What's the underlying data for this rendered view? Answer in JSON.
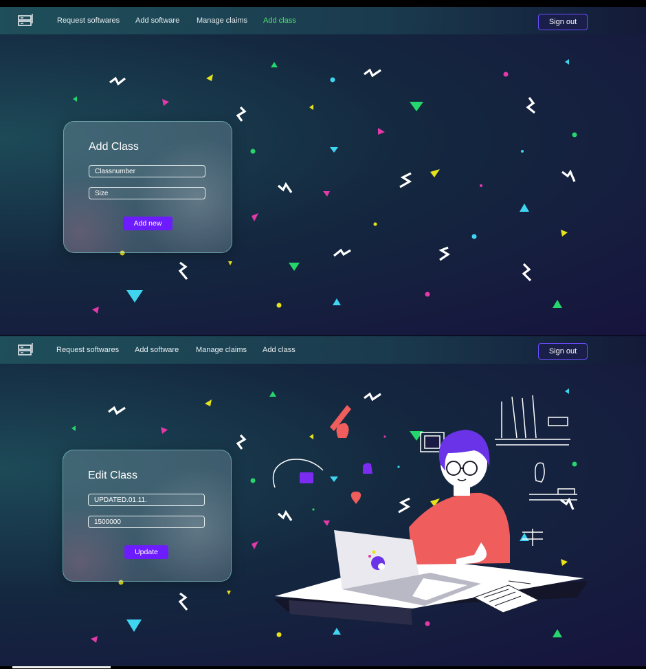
{
  "nav": {
    "links": [
      "Request softwares",
      "Add software",
      "Manage claims",
      "Add class"
    ],
    "sign_out": "Sign out"
  },
  "add_form": {
    "title": "Add Class",
    "classnumber_placeholder": "Classnumber",
    "size_placeholder": "Size",
    "button": "Add new"
  },
  "edit_form": {
    "title": "Edit Class",
    "classnumber_value": "UPDATED.01.11.",
    "size_value": "1500000",
    "button": "Update"
  },
  "colors": {
    "active_link": "#4ee66c",
    "button": "#6d1cff",
    "sign_out_border": "#6a4dff"
  },
  "icons": [
    "server-logo-icon",
    "confetti-decoration",
    "person-at-laptop-illustration"
  ]
}
